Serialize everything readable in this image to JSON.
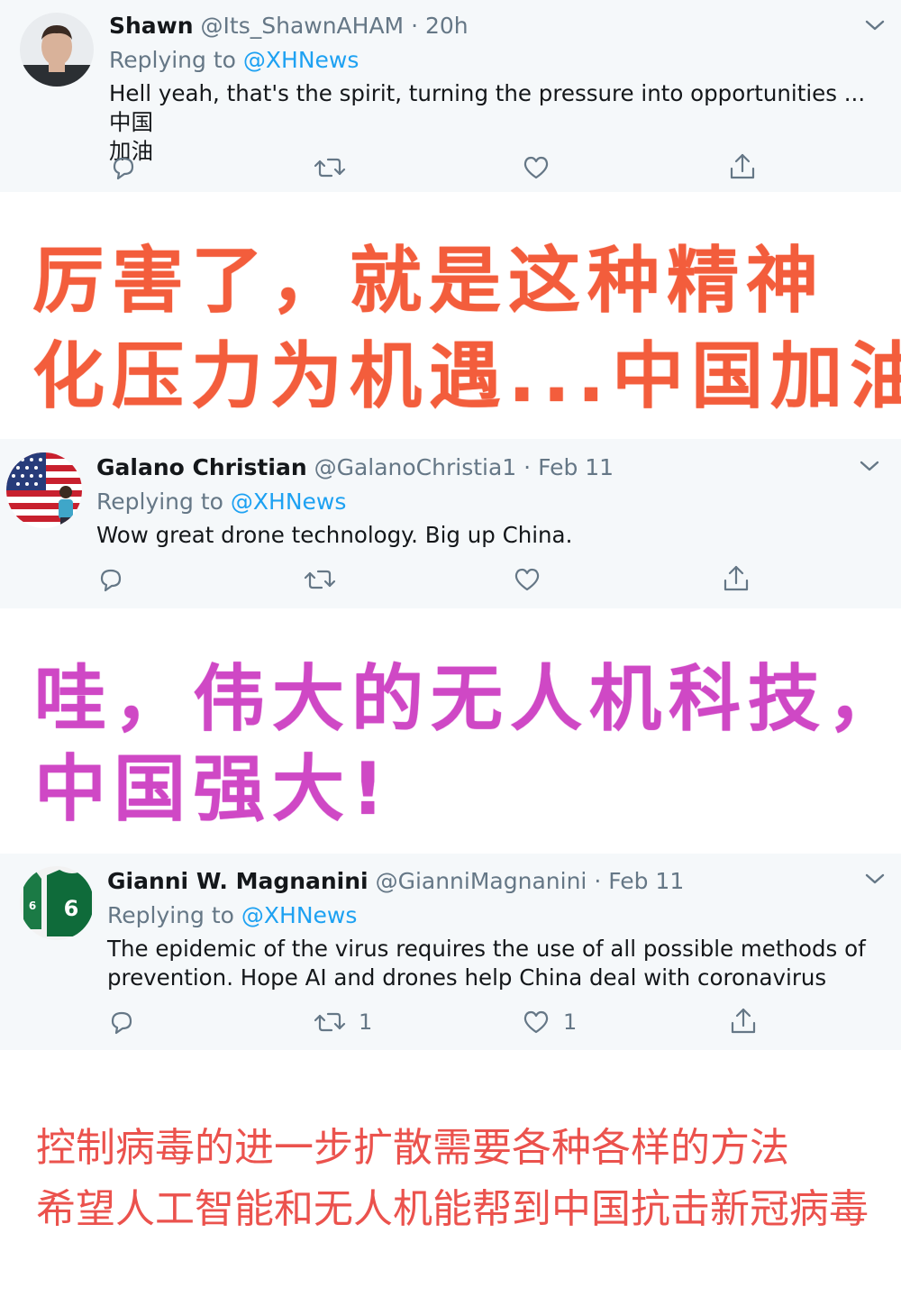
{
  "tweets": [
    {
      "name": "Shawn",
      "handle": "@Its_ShawnAHAM",
      "sep": "·",
      "time": "20h",
      "replying_label": "Replying to",
      "replying_to": "@XHNews",
      "text_line1": "Hell yeah, that's the spirit, turning the pressure into opportunities ... 中国",
      "text_line2": "加油",
      "retweets": "",
      "likes": ""
    },
    {
      "name": "Galano Christian",
      "handle": "@GalanoChristia1",
      "sep": "·",
      "time": "Feb 11",
      "replying_label": "Replying to",
      "replying_to": "@XHNews",
      "text_line1": "Wow great drone technology. Big up China.",
      "retweets": "",
      "likes": ""
    },
    {
      "name": "Gianni W. Magnanini",
      "handle": "@GianniMagnanini",
      "sep": "·",
      "time": "Feb 11",
      "replying_label": "Replying to",
      "replying_to": "@XHNews",
      "text_line1": "The epidemic of the virus requires the use of all possible methods of",
      "text_line2": "prevention. Hope AI and drones help China deal with coronavirus",
      "retweets": "1",
      "likes": "1"
    }
  ],
  "translations": {
    "t1_line1": "厉害了，就是这种精神",
    "t1_line2": "化压力为机遇...中国加油",
    "t2_line1": "哇，伟大的无人机科技，",
    "t2_line2": "中国强大!",
    "t3_line1": "控制病毒的进一步扩散需要各种各样的方法",
    "t3_line2": "希望人工智能和无人机能帮到中国抗击新冠病毒"
  },
  "colors": {
    "tweet_bg": "#f5f8fa",
    "mention": "#1da1f2",
    "meta": "#657786",
    "translation_1": "#f35d3c",
    "translation_2": "#cf48c5",
    "translation_3": "#eb524d"
  },
  "icons": [
    "reply-icon",
    "retweet-icon",
    "like-icon",
    "share-icon",
    "chevron-down-icon"
  ]
}
